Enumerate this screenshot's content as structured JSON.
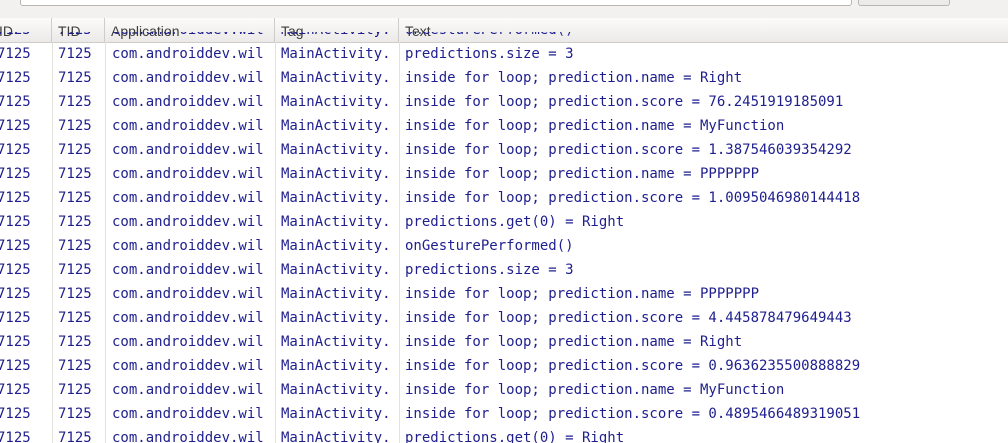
{
  "columns": [
    "ID",
    "TID",
    "Application",
    "Tag",
    "Text"
  ],
  "rows": [
    {
      "pid": "7125",
      "tid": "7125",
      "app": "com.androiddev.wil",
      "tag": "MainActivity.",
      "text": "onGesturePerformed()"
    },
    {
      "pid": "7125",
      "tid": "7125",
      "app": "com.androiddev.wil",
      "tag": "MainActivity.",
      "text": "predictions.size = 3"
    },
    {
      "pid": "7125",
      "tid": "7125",
      "app": "com.androiddev.wil",
      "tag": "MainActivity.",
      "text": "inside for loop; prediction.name = Right"
    },
    {
      "pid": "7125",
      "tid": "7125",
      "app": "com.androiddev.wil",
      "tag": "MainActivity.",
      "text": "inside for loop; prediction.score = 76.2451919185091"
    },
    {
      "pid": "7125",
      "tid": "7125",
      "app": "com.androiddev.wil",
      "tag": "MainActivity.",
      "text": "inside for loop; prediction.name = MyFunction"
    },
    {
      "pid": "7125",
      "tid": "7125",
      "app": "com.androiddev.wil",
      "tag": "MainActivity.",
      "text": "inside for loop; prediction.score = 1.387546039354292"
    },
    {
      "pid": "7125",
      "tid": "7125",
      "app": "com.androiddev.wil",
      "tag": "MainActivity.",
      "text": "inside for loop; prediction.name = PPPPPPP"
    },
    {
      "pid": "7125",
      "tid": "7125",
      "app": "com.androiddev.wil",
      "tag": "MainActivity.",
      "text": "inside for loop; prediction.score = 1.0095046980144418"
    },
    {
      "pid": "7125",
      "tid": "7125",
      "app": "com.androiddev.wil",
      "tag": "MainActivity.",
      "text": "predictions.get(0) = Right"
    },
    {
      "pid": "7125",
      "tid": "7125",
      "app": "com.androiddev.wil",
      "tag": "MainActivity.",
      "text": "onGesturePerformed()"
    },
    {
      "pid": "7125",
      "tid": "7125",
      "app": "com.androiddev.wil",
      "tag": "MainActivity.",
      "text": "predictions.size = 3"
    },
    {
      "pid": "7125",
      "tid": "7125",
      "app": "com.androiddev.wil",
      "tag": "MainActivity.",
      "text": "inside for loop; prediction.name = PPPPPPP"
    },
    {
      "pid": "7125",
      "tid": "7125",
      "app": "com.androiddev.wil",
      "tag": "MainActivity.",
      "text": "inside for loop; prediction.score = 4.445878479649443"
    },
    {
      "pid": "7125",
      "tid": "7125",
      "app": "com.androiddev.wil",
      "tag": "MainActivity.",
      "text": "inside for loop; prediction.name = Right"
    },
    {
      "pid": "7125",
      "tid": "7125",
      "app": "com.androiddev.wil",
      "tag": "MainActivity.",
      "text": "inside for loop; prediction.score = 0.9636235500888829"
    },
    {
      "pid": "7125",
      "tid": "7125",
      "app": "com.androiddev.wil",
      "tag": "MainActivity.",
      "text": "inside for loop; prediction.name = MyFunction"
    },
    {
      "pid": "7125",
      "tid": "7125",
      "app": "com.androiddev.wil",
      "tag": "MainActivity.",
      "text": "inside for loop; prediction.score = 0.4895466489319051"
    },
    {
      "pid": "7125",
      "tid": "7125",
      "app": "com.androiddev.wil",
      "tag": "MainActivity.",
      "text": "predictions.get(0) = Right"
    }
  ]
}
